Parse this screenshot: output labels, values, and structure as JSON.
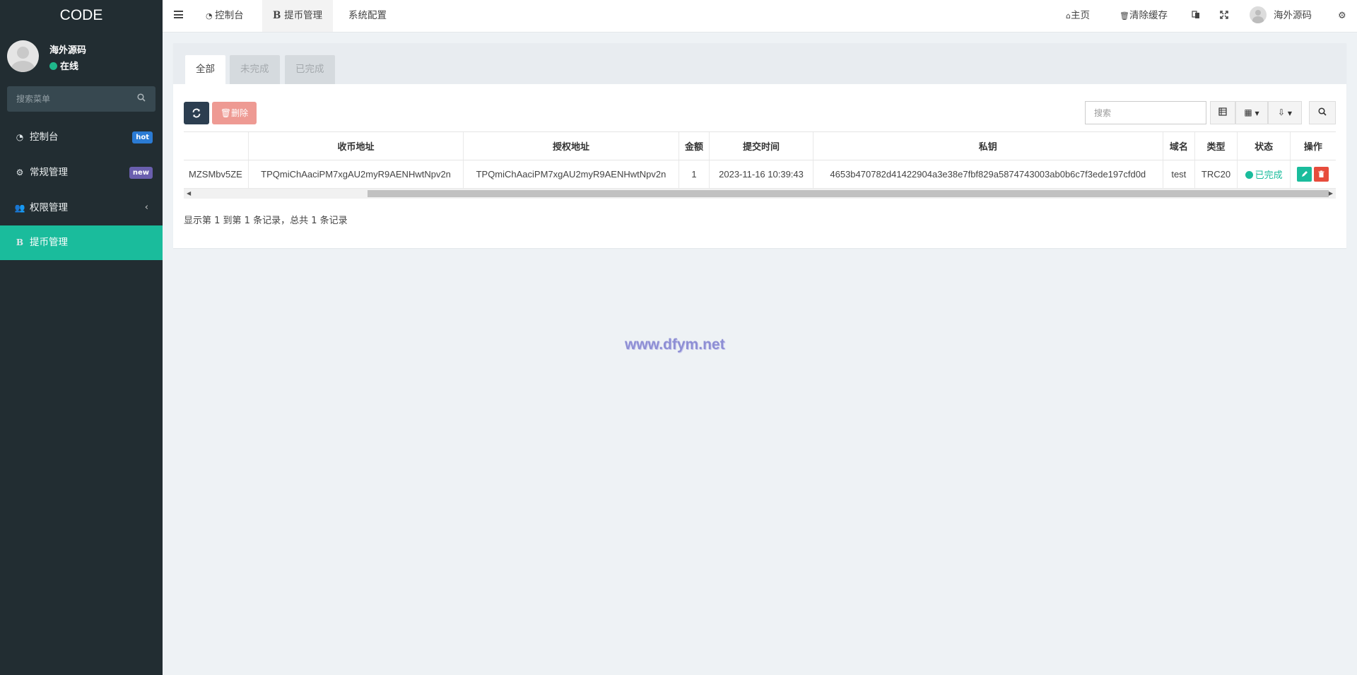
{
  "brand": "CODE",
  "user": {
    "name": "海外源码",
    "status": "在线"
  },
  "sidebar": {
    "search_placeholder": "搜索菜单",
    "items": [
      {
        "label": "控制台",
        "icon": "dashboard-icon",
        "badge": "hot"
      },
      {
        "label": "常规管理",
        "icon": "cogs-icon",
        "badge": "new"
      },
      {
        "label": "权限管理",
        "icon": "users-icon",
        "expandable": true
      },
      {
        "label": "提币管理",
        "icon": "bitcoin-icon",
        "active": true
      }
    ]
  },
  "topnav": {
    "tabs": [
      {
        "label": "控制台",
        "icon": "dashboard-icon"
      },
      {
        "label": "提币管理",
        "icon": "bitcoin-icon",
        "active": true
      },
      {
        "label": "系统配置"
      }
    ],
    "right": {
      "home": "主页",
      "clear_cache": "清除缓存",
      "user": "海外源码"
    }
  },
  "panel": {
    "tabs": [
      {
        "label": "全部",
        "active": true
      },
      {
        "label": "未完成"
      },
      {
        "label": "已完成"
      }
    ],
    "toolbar": {
      "delete_label": "删除",
      "search_placeholder": "搜索"
    }
  },
  "table": {
    "columns": [
      "",
      "收币地址",
      "授权地址",
      "金额",
      "提交时间",
      "私钥",
      "域名",
      "类型",
      "状态",
      "操作"
    ],
    "rows": [
      {
        "partial": "MZSMbv5ZE",
        "receive_address": "TPQmiChAaciPM7xgAU2myR9AENHwtNpv2n",
        "auth_address": "TPQmiChAaciPM7xgAU2myR9AENHwtNpv2n",
        "amount": "1",
        "submit_time": "2023-11-16 10:39:43",
        "private_key": "4653b470782d41422904a3e38e7fbf829a5874743003ab0b6c7f3ede197cfd0d",
        "domain": "test",
        "type": "TRC20",
        "status": "已完成"
      }
    ]
  },
  "pager_info": "显示第 1 到第 1 条记录，总共 1 条记录",
  "watermark": "www.dfym.net",
  "colors": {
    "sidebar_bg": "#222d32",
    "accent": "#1abc9c",
    "danger": "#e74c3c",
    "hot_badge": "#2b7bd4",
    "new_badge": "#6a5fae"
  }
}
